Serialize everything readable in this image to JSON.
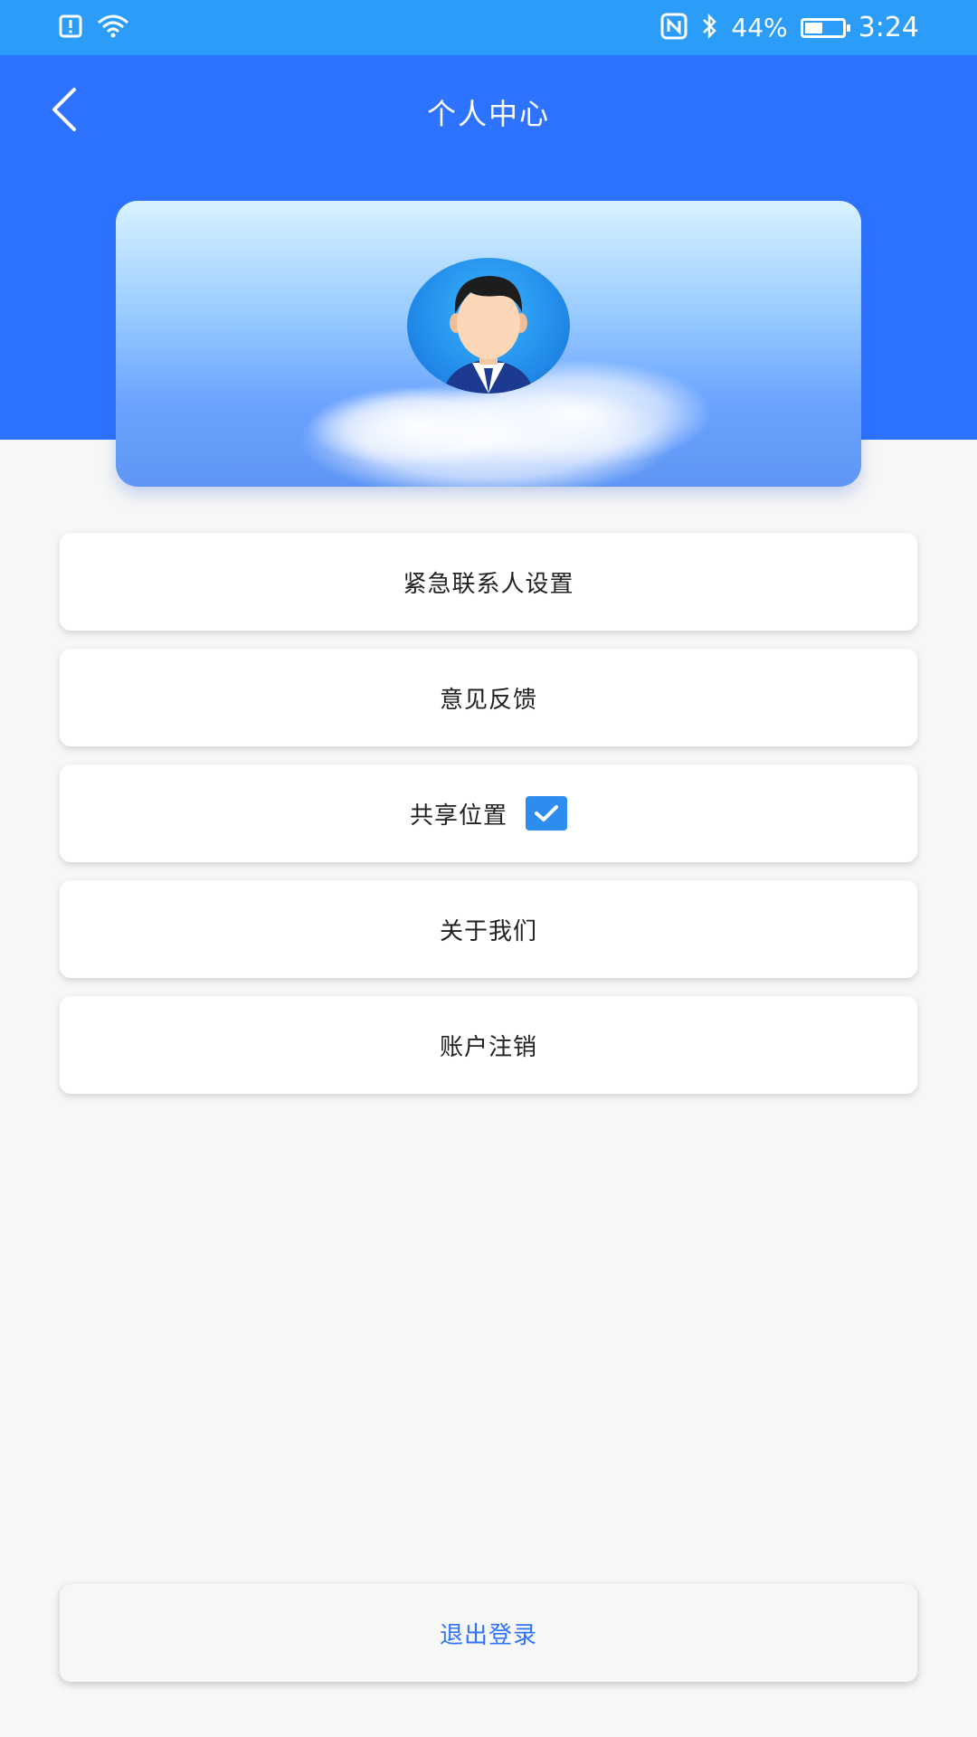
{
  "status_bar": {
    "battery_text": "44%",
    "time": "3:24",
    "icons": [
      "alert-icon",
      "wifi-icon",
      "nfc-icon",
      "bluetooth-icon",
      "battery-icon"
    ]
  },
  "header": {
    "title": "个人中心",
    "background_color": "#2d73ff"
  },
  "profile": {
    "avatar_icon": "user-avatar"
  },
  "menu": {
    "items": [
      {
        "label": "紧急联系人设置"
      },
      {
        "label": "意见反馈"
      },
      {
        "label": "共享位置",
        "checkbox_checked": true
      },
      {
        "label": "关于我们"
      },
      {
        "label": "账户注销"
      }
    ]
  },
  "logout": {
    "label": "退出登录",
    "color": "#2d73ff"
  }
}
